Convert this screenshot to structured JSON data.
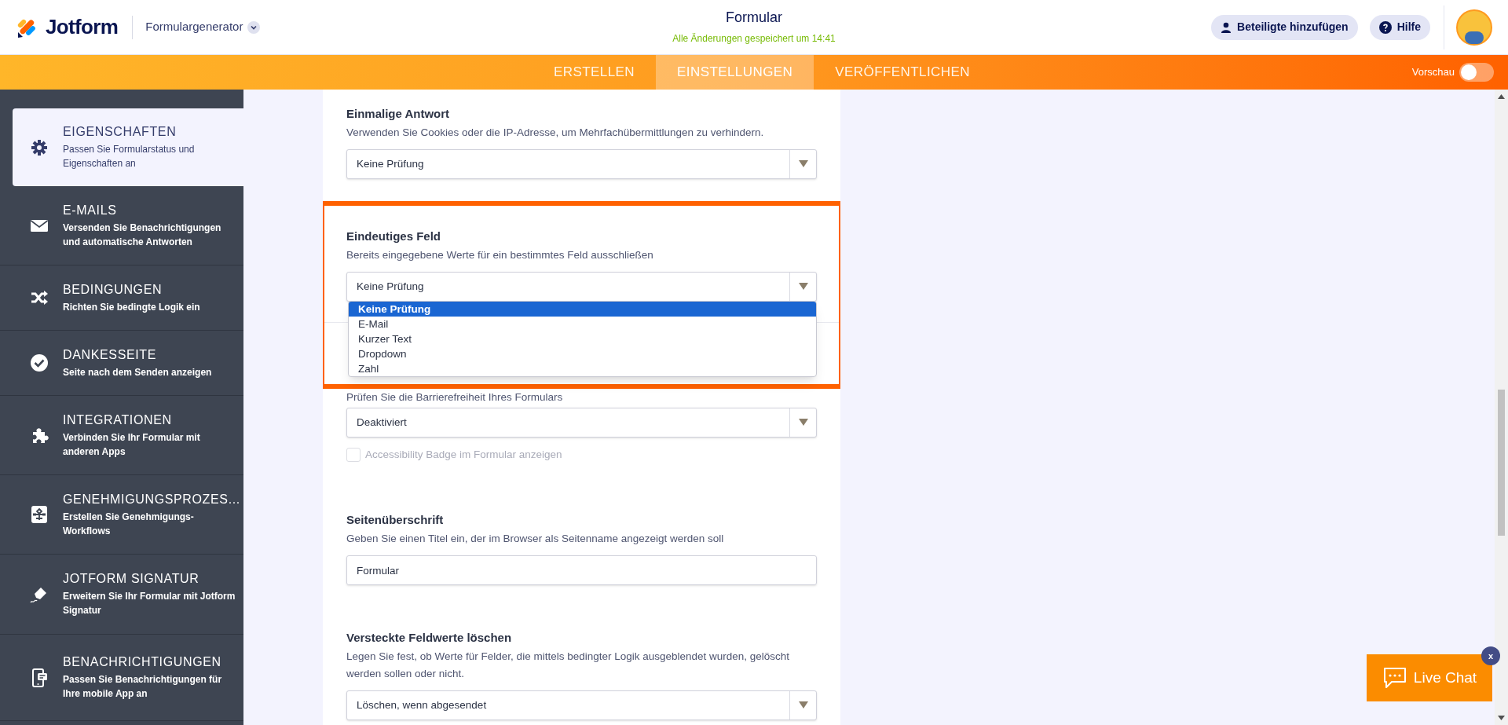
{
  "header": {
    "logo_text": "Jotform",
    "builder_menu": "Formulargenerator",
    "title": "Formular",
    "save_status": "Alle Änderungen gespeichert um 14:41",
    "buttons": [
      {
        "label": "Beteiligte hinzufügen"
      },
      {
        "label": "Hilfe"
      }
    ]
  },
  "tabs": [
    {
      "label": "ERSTELLEN",
      "selected": false
    },
    {
      "label": "EINSTELLUNGEN",
      "selected": true
    },
    {
      "label": "VERÖFFENTLICHEN",
      "selected": false
    }
  ],
  "preview": {
    "label": "Vorschau",
    "on": false
  },
  "sidebar": {
    "items": [
      {
        "title": "EIGENSCHAFTEN",
        "description": "Passen Sie Formularstatus und Eigenschaften an",
        "selected": true
      },
      {
        "title": "E-MAILS",
        "description": "Versenden Sie Benachrichtigungen und automatische Antworten",
        "selected": false
      },
      {
        "title": "BEDINGUNGEN",
        "description": "Richten Sie bedingte Logik ein",
        "selected": false
      },
      {
        "title": "DANKESSEITE",
        "description": "Seite nach dem Senden anzeigen",
        "selected": false
      },
      {
        "title": "INTEGRATIONEN",
        "description": "Verbinden Sie Ihr Formular mit anderen Apps",
        "selected": false
      },
      {
        "title": "GENEHMIGUNGSPROZES...",
        "description": "Erstellen Sie Genehmigungs-Workflows",
        "selected": false
      },
      {
        "title": "JOTFORM SIGNATUR",
        "description": "Erweitern Sie Ihr Formular mit Jotform Signatur",
        "selected": false
      },
      {
        "title": "BENACHRICHTIGUNGEN",
        "description": "Passen Sie Benachrichtigungen für Ihre mobile App an",
        "selected": false
      }
    ]
  },
  "sections": [
    {
      "kind": "select",
      "title": "Einmalige Antwort",
      "description": "Verwenden Sie Cookies oder die IP-Adresse, um Mehrfachübermittlungen zu verhindern.",
      "value": "Keine Prüfung",
      "highlighted": false
    },
    {
      "kind": "select",
      "title": "Eindeutiges Feld",
      "description": "Bereits eingegebene Werte für ein bestimmtes Feld ausschließen",
      "value": "Keine Prüfung",
      "highlighted": true,
      "options": [
        {
          "label": "Keine Prüfung",
          "selected": true
        },
        {
          "label": "E-Mail",
          "selected": false
        },
        {
          "label": "Kurzer Text",
          "selected": false
        },
        {
          "label": "Dropdown",
          "selected": false
        },
        {
          "label": "Zahl",
          "selected": false
        }
      ]
    },
    {
      "kind": "select",
      "description": "Prüfen Sie die Barrierefreiheit Ihres Formulars",
      "value": "Deaktiviert",
      "highlighted": false,
      "checkbox": {
        "label": "Accessibility Badge im Formular anzeigen",
        "checked": false,
        "disabled": true
      }
    },
    {
      "kind": "text",
      "title": "Seitenüberschrift",
      "description": "Geben Sie einen Titel ein, der im Browser als Seitenname angezeigt werden soll",
      "value": "Formular",
      "highlighted": false
    },
    {
      "kind": "select",
      "title": "Versteckte Feldwerte löschen",
      "description": "Legen Sie fest, ob Werte für Felder, die mittels bedingter Logik ausgeblendet wurden, gelöscht werden sollen oder nicht.",
      "value": "Löschen, wenn abgesendet",
      "highlighted": false
    }
  ],
  "live_chat": {
    "label": "Live Chat",
    "close": "x"
  }
}
